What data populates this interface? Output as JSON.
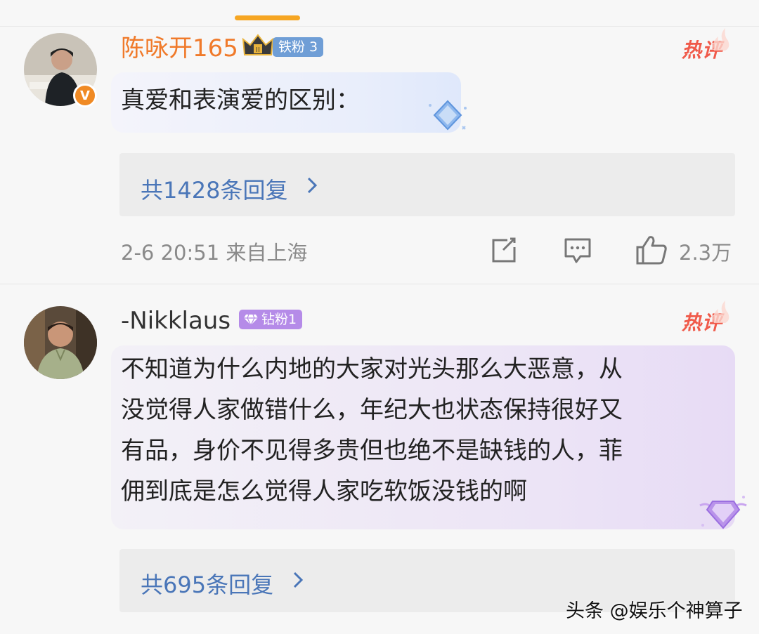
{
  "comments": [
    {
      "username": "陈咏开165",
      "fan_badge": "铁粉 3",
      "hot_label": "热评",
      "text": "真爱和表演爱的区别：",
      "replies_label": "共1428条回复",
      "time_location": "2-6 20:51 来自上海",
      "likes": "2.3万",
      "verified_label": "V"
    },
    {
      "username": "-Nikklaus",
      "fan_badge": "钻粉1",
      "hot_label": "热评",
      "text_lines": [
        "不知道为什么内地的大家对光头那么大恶意，从",
        "没觉得人家做错什么，年纪大也状态保持很好又",
        "有品，身价不见得多贵但也绝不是缺钱的人，菲",
        "佣到底是怎么觉得人家吃软饭没钱的啊"
      ],
      "replies_label": "共695条回复"
    }
  ],
  "watermark": "头条 @娱乐个神算子",
  "icons": {
    "reply_chevron": "chevron-right-icon",
    "share": "share-icon",
    "comment": "comment-icon",
    "like": "thumbs-up-icon"
  },
  "colors": {
    "username_highlight": "#f07a2a",
    "link_blue": "#4a76b8",
    "hot_red": "#f05a4a",
    "accent_orange": "#f6a623"
  }
}
